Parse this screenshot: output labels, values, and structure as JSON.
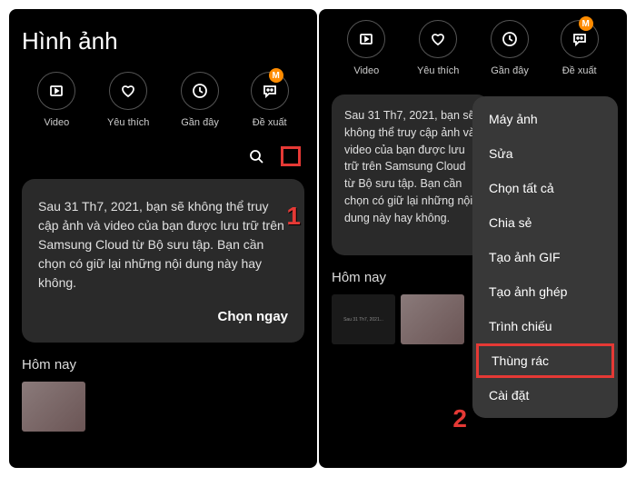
{
  "title": "Hình ảnh",
  "icons": [
    {
      "label": "Video",
      "name": "video-icon"
    },
    {
      "label": "Yêu thích",
      "name": "heart-icon"
    },
    {
      "label": "Gần đây",
      "name": "clock-icon"
    },
    {
      "label": "Đề xuất",
      "name": "chat-icon",
      "badge": "M"
    }
  ],
  "card": {
    "text": "Sau 31 Th7, 2021, bạn sẽ không thể truy cập ảnh và video của bạn được lưu trữ trên Samsung Cloud từ Bộ sưu tập. Bạn cần chọn có giữ lại những nội dung này hay không.",
    "text_cut": "Sau 31 Th7, 2021, bạn sẽ không thể truy cập ảnh và video của bạn được lưu trữ trên Samsung Cloud từ Bộ sưu tập. Bạn cần chọn có giữ lại những nội dung này hay không.",
    "button": "Chọn ngay"
  },
  "section": "Hôm nay",
  "menu": [
    "Máy ảnh",
    "Sửa",
    "Chọn tất cả",
    "Chia sẻ",
    "Tạo ảnh GIF",
    "Tạo ảnh ghép",
    "Trình chiếu",
    "Thùng rác",
    "Cài đặt"
  ],
  "steps": {
    "one": "1",
    "two": "2"
  }
}
